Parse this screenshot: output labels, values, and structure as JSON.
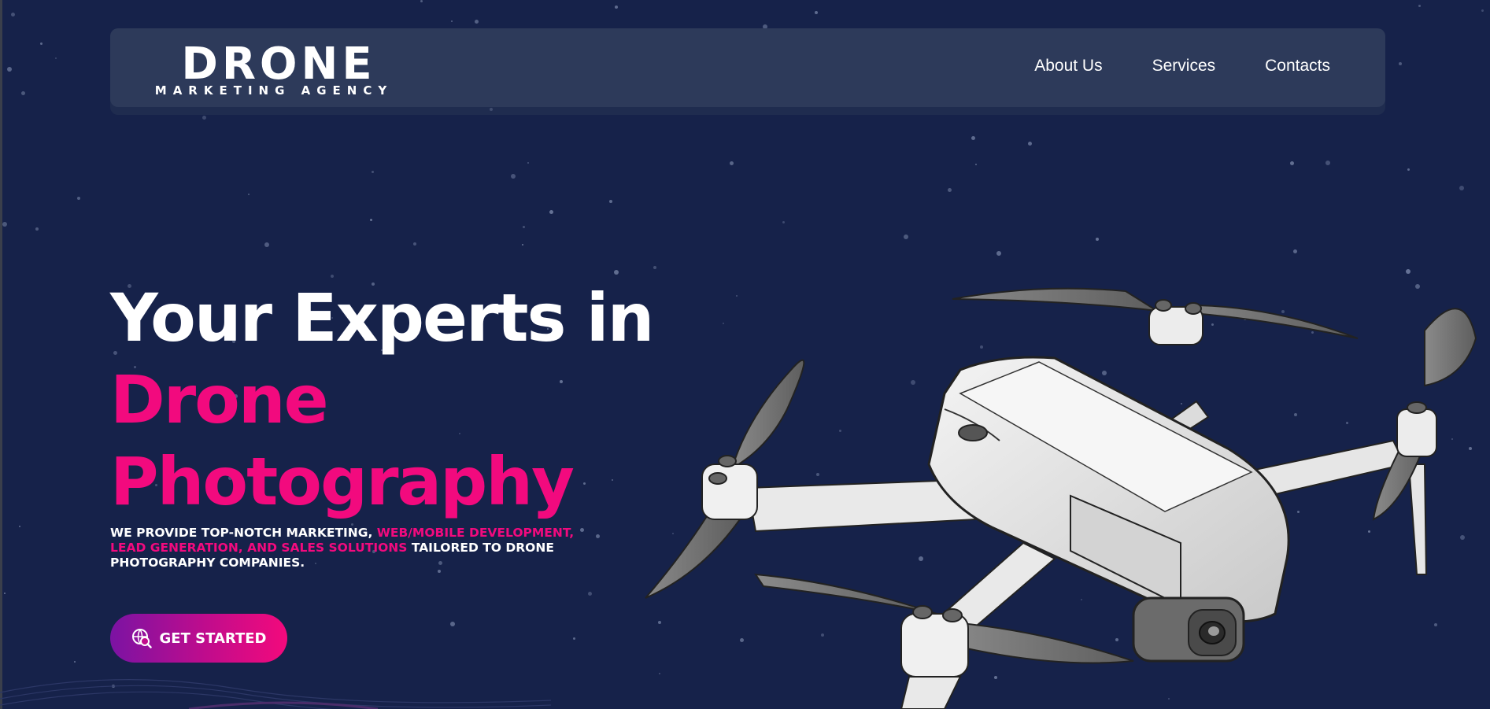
{
  "brand": {
    "logo_main": "DRONE",
    "logo_sub": "MARKETING AGENCY"
  },
  "nav": {
    "items": [
      {
        "label": "About Us"
      },
      {
        "label": "Services"
      },
      {
        "label": "Contacts"
      }
    ]
  },
  "hero": {
    "title_line1": "Your Experts in",
    "title_line2": "Drone",
    "title_line3": "Photography",
    "desc_part1": "WE PROVIDE TOP-NOTCH MARKETING, ",
    "desc_highlight": "WEB/MOBILE DEVELOPMENT, LEAD GENERATION, AND SALES SOLUTIONS",
    "desc_part2": " TAILORED TO DRONE PHOTOGRAPHY COMPANIES.",
    "cta_label": "GET STARTED",
    "cta_icon": "globe-search-icon"
  },
  "colors": {
    "background": "#16224a",
    "navbar": "#2d3a5a",
    "accent_pink": "#f20a7e",
    "accent_purple": "#7b13a3",
    "text": "#ffffff"
  },
  "illustration": {
    "subject": "drone-illustration"
  }
}
